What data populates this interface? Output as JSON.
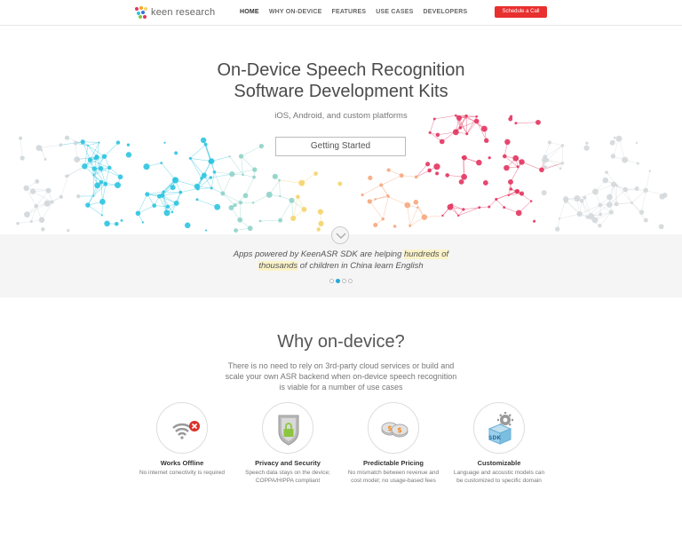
{
  "nav": {
    "brand": "keen research",
    "items": [
      {
        "label": "HOME",
        "active": true
      },
      {
        "label": "WHY ON-DEVICE",
        "active": false
      },
      {
        "label": "FEATURES",
        "active": false
      },
      {
        "label": "USE CASES",
        "active": false
      },
      {
        "label": "DEVELOPERS",
        "active": false
      }
    ],
    "cta": "Schedule a Call"
  },
  "hero": {
    "title_line1": "On-Device Speech Recognition",
    "title_line2": "Software Development Kits",
    "subtitle": "iOS, Android, and custom platforms",
    "button": "Getting Started"
  },
  "slider": {
    "quote_part1": "Apps powered by KeenASR SDK are helping ",
    "quote_highlight1": "hundreds of",
    "quote_highlight2": "thousands",
    "quote_part2": " of children in China learn English",
    "dot_count": 4,
    "active_dot": 1
  },
  "why": {
    "title": "Why on-device?",
    "description": "There is no need to rely on 3rd-party cloud services or build and scale your own ASR backend when on-device speech recognition is viable for a number of use cases"
  },
  "features": [
    {
      "icon": "wifi-offline-icon",
      "title": "Works Offline",
      "desc": "No internet conectivity is required"
    },
    {
      "icon": "shield-lock-icon",
      "title": "Privacy and Security",
      "desc": "Speech data stays on the device; COPPA/HIPPA compliant"
    },
    {
      "icon": "coins-icon",
      "title": "Predictable Pricing",
      "desc": "No mismatch between revenue and cost model; no usage-based fees"
    },
    {
      "icon": "sdk-gear-icon",
      "title": "Customizable",
      "desc": "Language and acoustic models can be customized to specific domain"
    }
  ],
  "colors": {
    "accent_red": "#e8302f",
    "dot_active": "#27a9d8",
    "network_cyan": "#2ec4e0",
    "network_pink": "#e3345f",
    "network_yellow": "#f5d46b"
  }
}
